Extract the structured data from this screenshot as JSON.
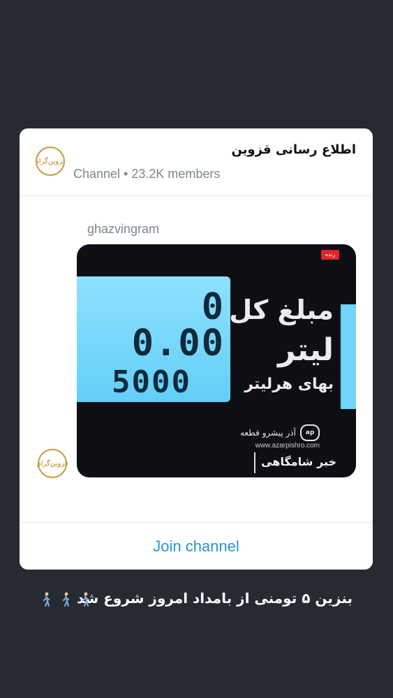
{
  "channel": {
    "title": "اطلاع رسانی قزوین",
    "meta": "Channel • 23.2K members",
    "avatar_text": "قزوین‌گرام"
  },
  "post": {
    "author": "ghazvingram",
    "media": {
      "live_badge": "زنده",
      "lcd_amount": "0",
      "lcd_liter": "0.00",
      "lcd_price": "5000",
      "label_total": "مبلغ کل",
      "label_liter": "لیتر",
      "label_unit_price": "بهای هرلیتر",
      "brand_logo": "ap",
      "brand_name": "آذر پیشرو قطعه",
      "brand_url": "www.azarpishro.com",
      "news_label": "خبر شامگاهی"
    }
  },
  "join_button": {
    "label": "Join channel",
    "color": "#2a93d6"
  },
  "caption": {
    "text": "بنزین ۵ تومنی از بامداد امروز شروع شد",
    "emoji_icon": "person-walking-icon"
  },
  "colors": {
    "background": "#262a31",
    "card": "#ffffff",
    "accent_gold": "#c99a3a"
  }
}
